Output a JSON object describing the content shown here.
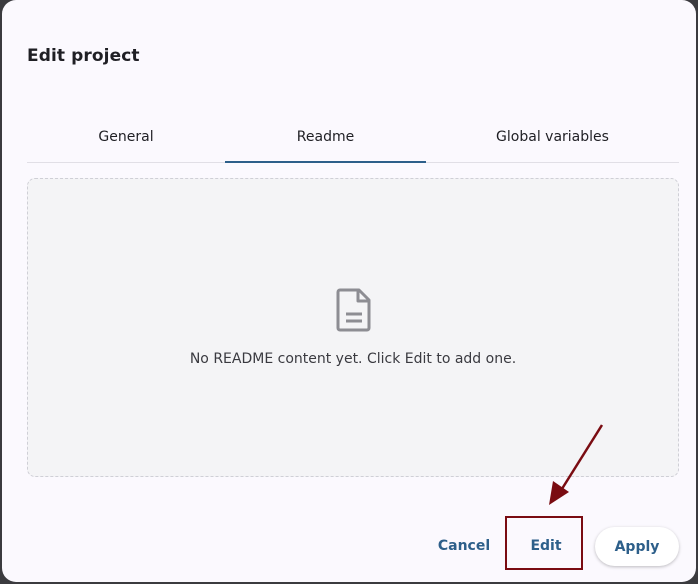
{
  "dialog": {
    "title": "Edit project"
  },
  "tabs": [
    {
      "label": "General",
      "active": false
    },
    {
      "label": "Readme",
      "active": true
    },
    {
      "label": "Global variables",
      "active": false
    }
  ],
  "readme": {
    "icon": "document-icon",
    "empty_text": "No README content yet. Click Edit to add one."
  },
  "actions": {
    "cancel_label": "Cancel",
    "edit_label": "Edit",
    "apply_label": "Apply"
  },
  "colors": {
    "accent": "#2d5f8a",
    "annotation": "#7a0c12",
    "surface": "#fbf9fe"
  }
}
